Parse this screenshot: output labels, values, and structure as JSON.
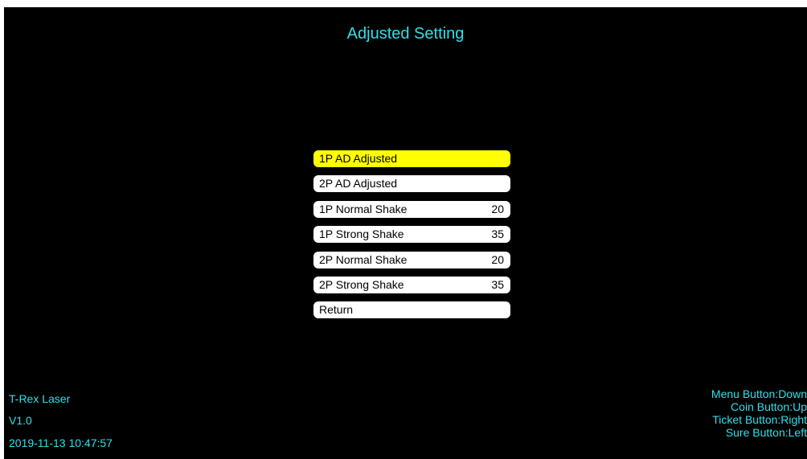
{
  "title": "Adjusted Setting",
  "menu": {
    "items": [
      {
        "label": "1P AD Adjusted",
        "value": ""
      },
      {
        "label": "2P AD Adjusted",
        "value": ""
      },
      {
        "label": "1P Normal Shake",
        "value": "20"
      },
      {
        "label": "1P Strong Shake",
        "value": "35"
      },
      {
        "label": "2P Normal Shake",
        "value": "20"
      },
      {
        "label": "2P Strong Shake",
        "value": "35"
      },
      {
        "label": "Return",
        "value": ""
      }
    ],
    "selected_index": 0
  },
  "footer": {
    "game_name": "T-Rex Laser",
    "version": "V1.0",
    "datetime": "2019-11-13 10:47:57"
  },
  "controls": {
    "menu": "Menu Button:Down",
    "coin": "Coin Button:Up",
    "ticket": "Ticket Button:Right",
    "sure": "Sure Button:Left"
  },
  "colors": {
    "background": "#000000",
    "accent": "#2ee0ea",
    "selected": "#ffff00",
    "item": "#ffffff"
  }
}
